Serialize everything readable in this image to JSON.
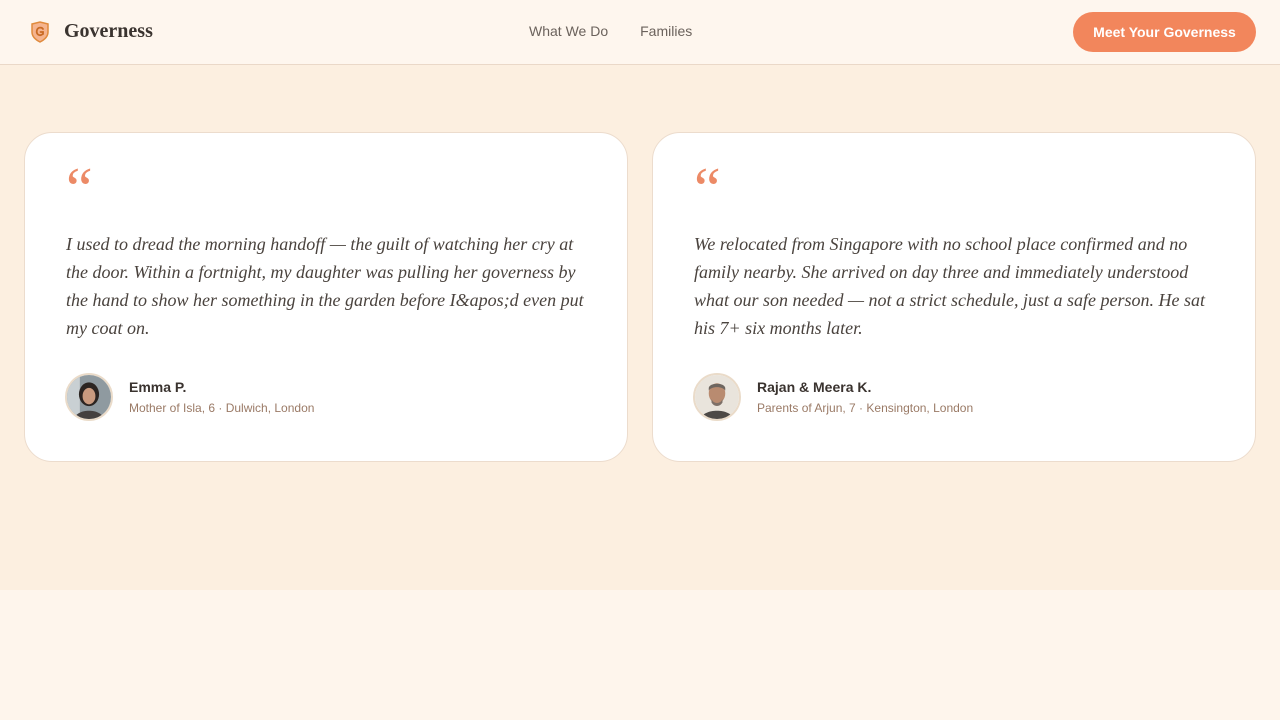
{
  "nav": {
    "brand": "Governess",
    "links": [
      "What We Do",
      "Families"
    ],
    "cta": "Meet Your Governess"
  },
  "testimonials": [
    {
      "quote_mark": "“",
      "quote": "I used to dread the morning handoff — the guilt of watching her cry at the door. Within a fortnight, my daughter was pulling her governess by the hand to show her something in the garden before I&apos;d even put my coat on.",
      "name": "Emma P.",
      "meta": "Mother of Isla, 6 · Dulwich, London"
    },
    {
      "quote_mark": "“",
      "quote": "We relocated from Singapore with no school place confirmed and no family nearby. She arrived on day three and immediately understood what our son needed — not a strict schedule, just a safe person. He sat his 7+ six months later.",
      "name": "Rajan & Meera K.",
      "meta": "Parents of Arjun, 7 · Kensington, London"
    }
  ],
  "colors": {
    "accent": "#f2865c",
    "quote_mark": "#ec8a66",
    "section_bg": "#fcefe0",
    "card_bg": "#ffffff"
  },
  "icons": {
    "brand": "shield-g-logo-icon"
  }
}
